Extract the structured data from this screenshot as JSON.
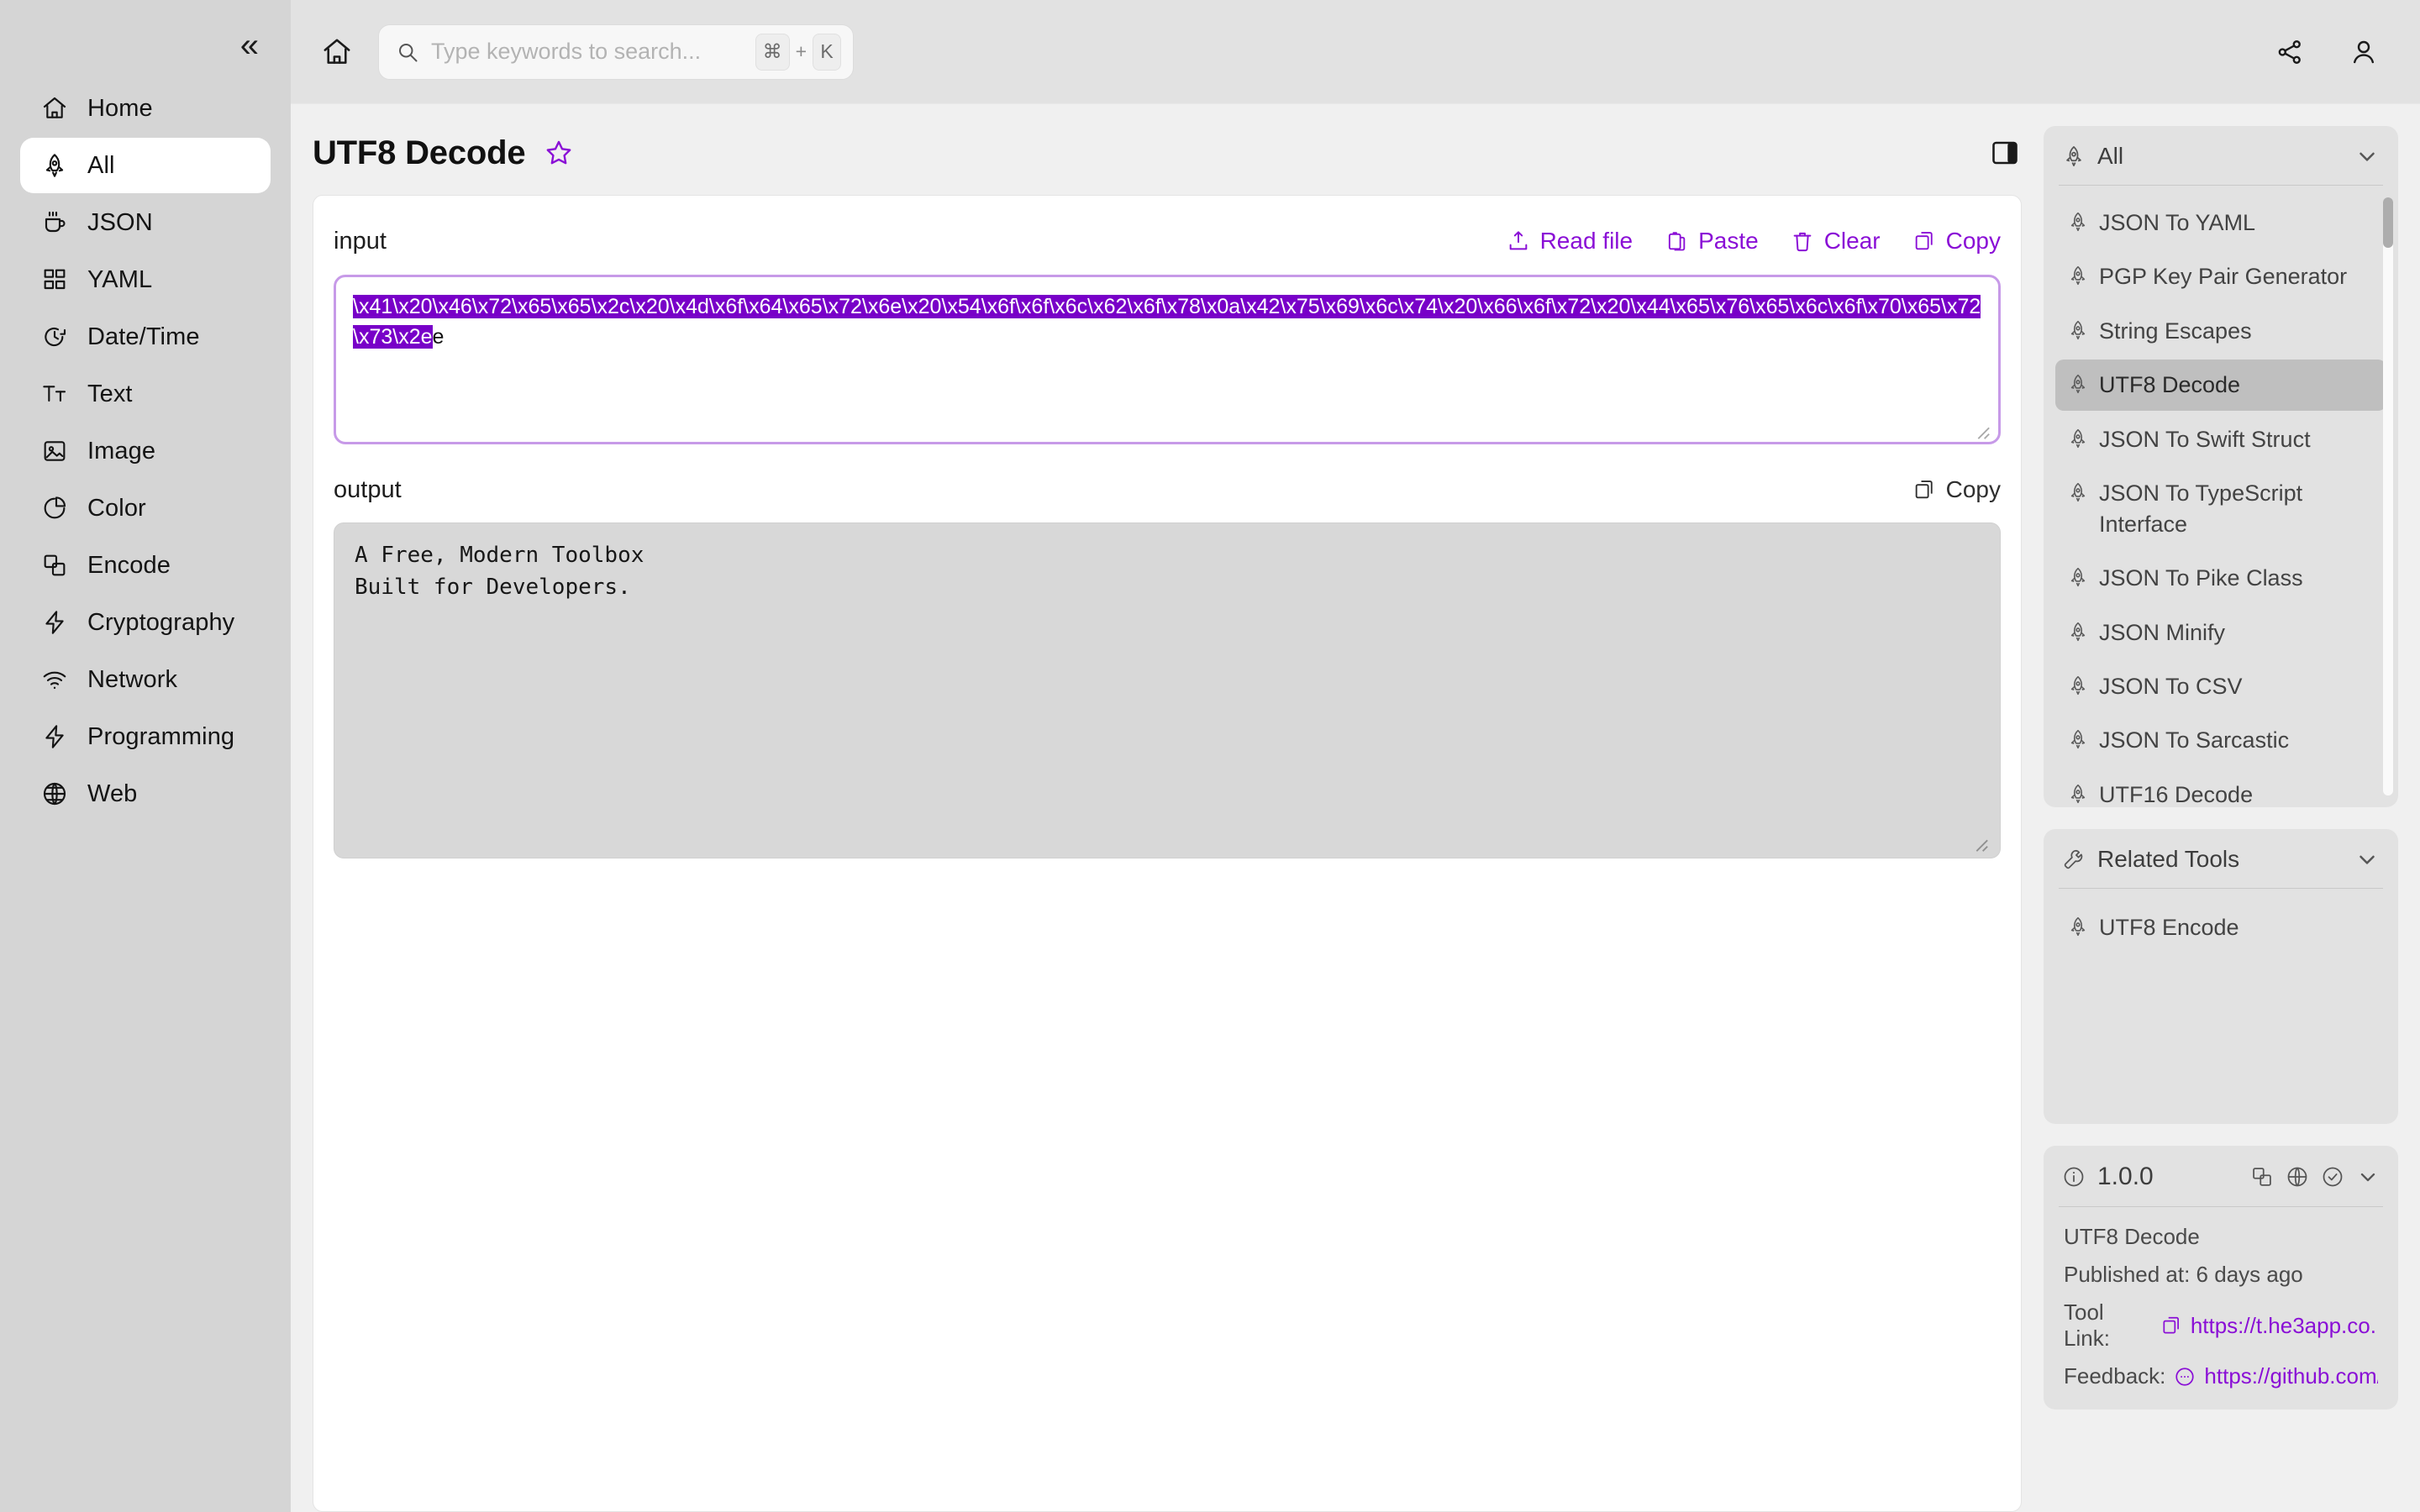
{
  "sidebar": {
    "collapse_label": "«",
    "items": [
      {
        "label": "Home",
        "icon": "home-icon"
      },
      {
        "label": "All",
        "icon": "rocket-icon",
        "active": true
      },
      {
        "label": "JSON",
        "icon": "coffee-icon"
      },
      {
        "label": "YAML",
        "icon": "grid-icon"
      },
      {
        "label": "Date/Time",
        "icon": "clock-icon"
      },
      {
        "label": "Text",
        "icon": "text-icon"
      },
      {
        "label": "Image",
        "icon": "image-icon"
      },
      {
        "label": "Color",
        "icon": "pie-chart-icon"
      },
      {
        "label": "Encode",
        "icon": "copy-layers-icon"
      },
      {
        "label": "Cryptography",
        "icon": "bolt-icon"
      },
      {
        "label": "Network",
        "icon": "wifi-icon"
      },
      {
        "label": "Programming",
        "icon": "bolt-icon"
      },
      {
        "label": "Web",
        "icon": "globe-icon"
      }
    ]
  },
  "topbar": {
    "home_icon": "home-icon",
    "search": {
      "placeholder": "Type keywords to search...",
      "value": "",
      "kbd_cmd": "⌘",
      "kbd_plus": "+",
      "kbd_key": "K"
    },
    "share_icon": "share-icon",
    "account_icon": "user-icon"
  },
  "page": {
    "title": "UTF8 Decode",
    "favorite_icon": "star-icon",
    "panel_toggle_icon": "panel-right-icon"
  },
  "tool": {
    "input_label": "input",
    "input_value": "\\x41\\x20\\x46\\x72\\x65\\x65\\x2c\\x20\\x4d\\x6f\\x64\\x65\\x72\\x6e\\x20\\x54\\x6f\\x6f\\x6c\\x62\\x6f\\x78\\x0a\\x42\\x75\\x69\\x6c\\x74\\x20\\x66\\x6f\\x72\\x20\\x44\\x65\\x76\\x65\\x6c\\x6f\\x70\\x65\\x72\\x73\\x2e",
    "input_selected": true,
    "actions": [
      {
        "label": "Read file",
        "icon": "upload-icon"
      },
      {
        "label": "Paste",
        "icon": "paste-icon"
      },
      {
        "label": "Clear",
        "icon": "trash-icon"
      },
      {
        "label": "Copy",
        "icon": "copy-icon"
      }
    ],
    "output_label": "output",
    "output_copy_label": "Copy",
    "output_copy_icon": "copy-icon",
    "output_value": "A Free, Modern Toolbox\nBuilt for Developers."
  },
  "right_panel": {
    "all_section": {
      "title": "All",
      "icon": "rocket-icon",
      "chevron_icon": "chevron-down-icon",
      "items": [
        {
          "label": "JSON To YAML"
        },
        {
          "label": "PGP Key Pair Generator"
        },
        {
          "label": "String Escapes"
        },
        {
          "label": "UTF8 Decode",
          "active": true
        },
        {
          "label": "JSON To Swift Struct"
        },
        {
          "label": "JSON To TypeScript Interface"
        },
        {
          "label": "JSON To Pike Class"
        },
        {
          "label": "JSON Minify"
        },
        {
          "label": "JSON To CSV"
        },
        {
          "label": "JSON To Sarcastic"
        },
        {
          "label": "UTF16 Decode"
        }
      ]
    },
    "related_section": {
      "title": "Related Tools",
      "icon": "wrench-icon",
      "chevron_icon": "chevron-down-icon",
      "items": [
        {
          "label": "UTF8 Encode"
        }
      ]
    },
    "info_section": {
      "version": "1.0.0",
      "info_icon": "info-circle-icon",
      "actions": [
        "copy-layers-icon",
        "globe-icon",
        "check-circle-icon",
        "chevron-down-icon"
      ],
      "tool_name": "UTF8 Decode",
      "published": "Published at: 6 days ago",
      "tool_link_label": "Tool Link:",
      "tool_link_url": "https://t.he3app.co...",
      "tool_link_icon": "copy-icon",
      "feedback_label": "Feedback:",
      "feedback_url": "https://github.com/...",
      "feedback_icon": "comment-icon"
    }
  },
  "colors": {
    "accent": "#8a0fd6",
    "selection": "#7800c8",
    "sidebar_bg": "#d5d5d5",
    "panel_bg": "#e2e2e2"
  }
}
